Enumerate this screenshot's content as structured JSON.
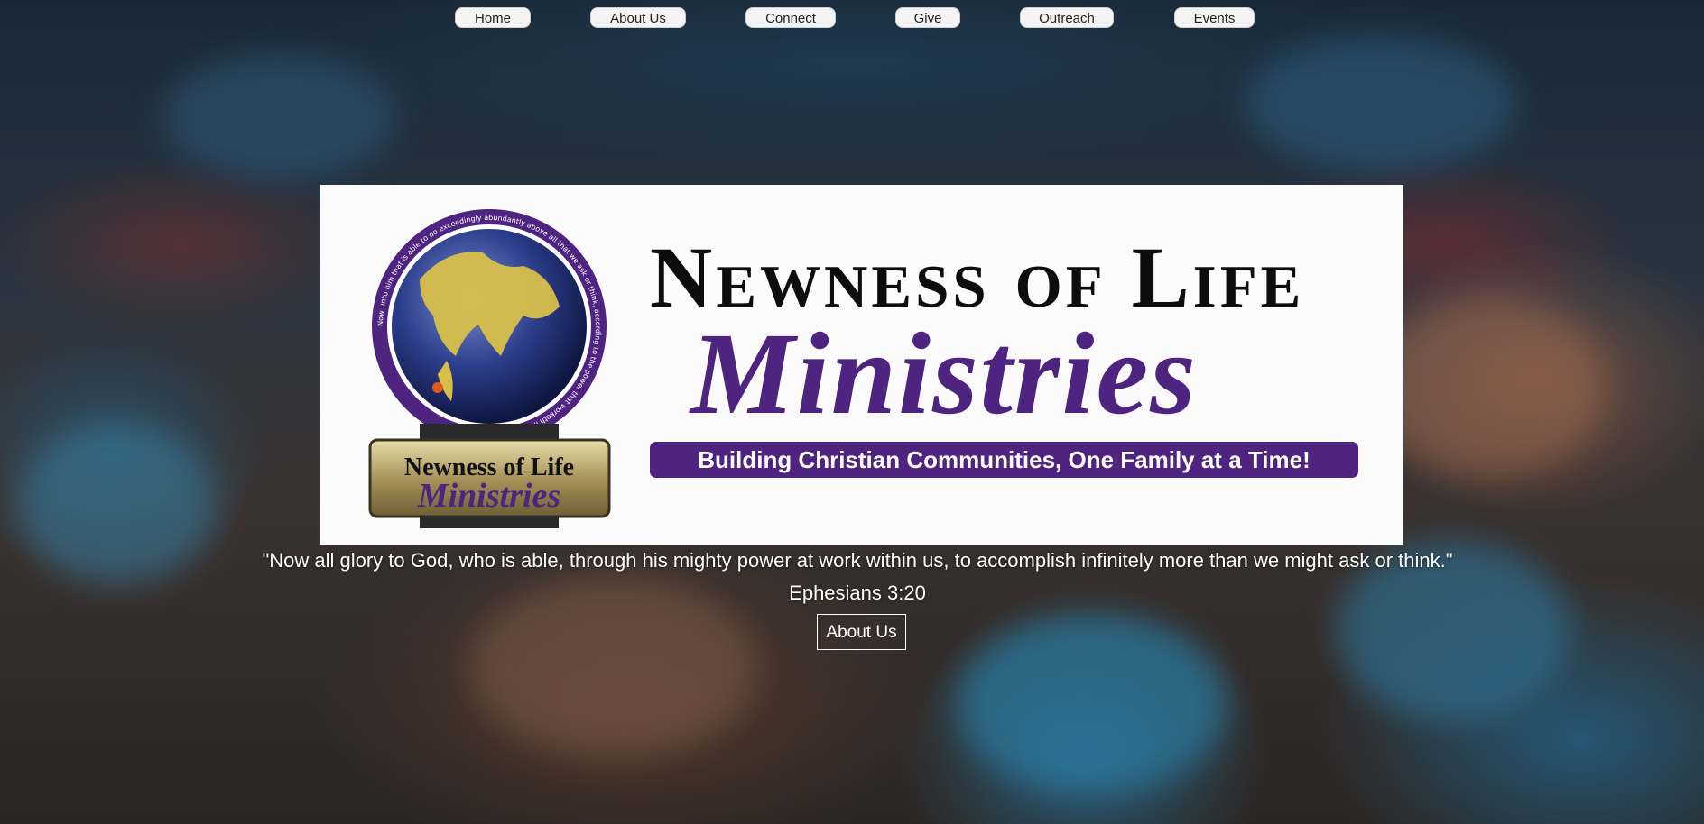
{
  "nav": {
    "items": [
      {
        "label": "Home"
      },
      {
        "label": "About Us"
      },
      {
        "label": "Connect"
      },
      {
        "label": "Give"
      },
      {
        "label": "Outreach"
      },
      {
        "label": "Events"
      }
    ]
  },
  "banner": {
    "title": "Newness of Life",
    "subtitle": "Ministries",
    "tagline": "Building Christian Communities, One Family at a Time!",
    "emblem": {
      "ring_text": "Now unto him that is able to do exceedingly abundantly above all that we ask or think, according to the power that worketh in us. • Eph. 3:20",
      "plaque_title": "Newness of Life",
      "plaque_subtitle": "Ministries",
      "icon": "globe-icon"
    }
  },
  "hero": {
    "verse": "\"Now all glory to God, who is able, through his mighty power at work within us, to accomplish infinitely more than we might ask or think.\" Ephesians 3:20",
    "button_label": "About Us"
  },
  "colors": {
    "brand_purple": "#4f2380",
    "gold": "#c9b26a",
    "nav_bg": "#f4f4f4"
  }
}
